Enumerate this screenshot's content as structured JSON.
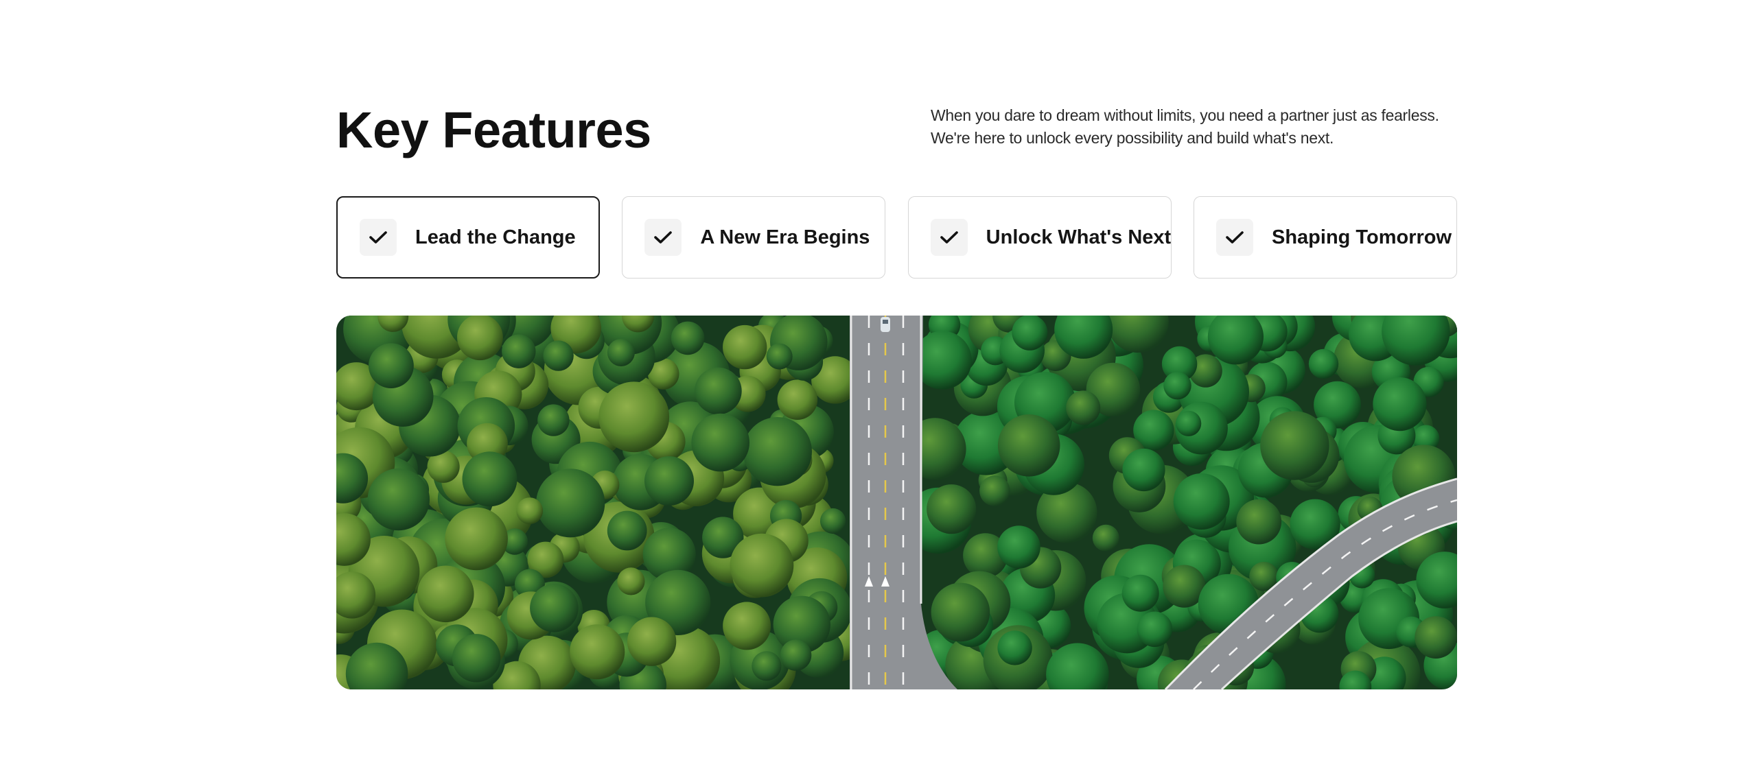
{
  "section": {
    "title": "Key Features",
    "description": "When you dare to dream without limits, you need a partner just as fearless. We're here to unlock every possibility and build what's next."
  },
  "features": [
    {
      "label": "Lead the Change",
      "icon": "check-icon",
      "active": true
    },
    {
      "label": "A New Era Begins",
      "icon": "check-icon",
      "active": false
    },
    {
      "label": "Unlock What's Next",
      "icon": "check-icon",
      "active": false
    },
    {
      "label": "Shaping Tomorrow",
      "icon": "check-icon",
      "active": false
    }
  ],
  "hero_image": {
    "subject": "aerial-forest-road-photo"
  },
  "colors": {
    "text": "#111111",
    "card_border": "#d6d6d6",
    "card_active_border": "#1a1a1a",
    "icon_bg": "#f3f3f3",
    "forest_dark": "#1f4a26",
    "road": "#8f9296"
  }
}
